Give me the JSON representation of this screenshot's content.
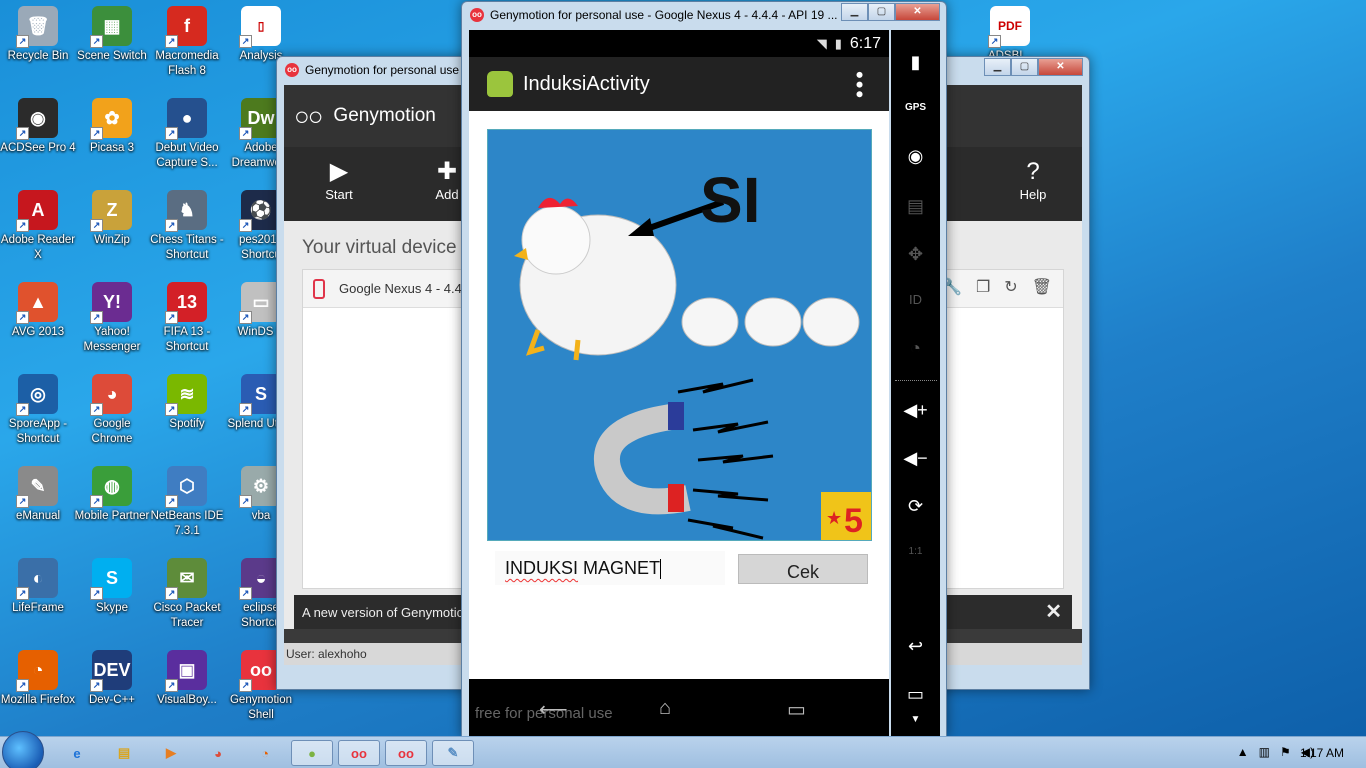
{
  "desktop": {
    "icons": [
      {
        "label": "Recycle Bin",
        "color": "#9aa9b8",
        "glyph": "🗑"
      },
      {
        "label": "Scene Switch",
        "color": "#3c8f3c",
        "glyph": "▦"
      },
      {
        "label": "Macromedia Flash 8",
        "color": "#d62a1f",
        "glyph": "f"
      },
      {
        "label": "Analysis",
        "color": "#ffffff",
        "glyph": "▯"
      },
      {
        "label": "ACDSee Pro 4",
        "color": "#2b2b2b",
        "glyph": "◉"
      },
      {
        "label": "Picasa 3",
        "color": "#f2a21b",
        "glyph": "✿"
      },
      {
        "label": "Debut Video Capture S...",
        "color": "#25508e",
        "glyph": "●"
      },
      {
        "label": "Adobe Dreamwe...",
        "color": "#4d7a1e",
        "glyph": "Dw"
      },
      {
        "label": "Adobe Reader X",
        "color": "#c6171e",
        "glyph": "A"
      },
      {
        "label": "WinZip",
        "color": "#c9a23a",
        "glyph": "Z"
      },
      {
        "label": "Chess Titans - Shortcut",
        "color": "#5a6d82",
        "glyph": "♞"
      },
      {
        "label": "pes2013 Shortcu",
        "color": "#1d2b4a",
        "glyph": "⚽"
      },
      {
        "label": "AVG 2013",
        "color": "#e0522d",
        "glyph": "▲"
      },
      {
        "label": "Yahoo! Messenger",
        "color": "#6b2c91",
        "glyph": "Y!"
      },
      {
        "label": "FIFA 13 - Shortcut",
        "color": "#d32027",
        "glyph": "13"
      },
      {
        "label": "WinDS P",
        "color": "#c0c0c0",
        "glyph": "▭"
      },
      {
        "label": "SporeApp - Shortcut",
        "color": "#1c5fa6",
        "glyph": "◎"
      },
      {
        "label": "Google Chrome",
        "color": "#dd4b39",
        "glyph": "◕"
      },
      {
        "label": "Spotify",
        "color": "#7ab800",
        "glyph": "≋"
      },
      {
        "label": "Splend Utility",
        "color": "#2a5cb3",
        "glyph": "S"
      },
      {
        "label": "eManual",
        "color": "#8a8a8a",
        "glyph": "✎"
      },
      {
        "label": "Mobile Partner",
        "color": "#3a9e3a",
        "glyph": "◍"
      },
      {
        "label": "NetBeans IDE 7.3.1",
        "color": "#3f7dc2",
        "glyph": "⬡"
      },
      {
        "label": "vba",
        "color": "#9aa",
        "glyph": "⚙"
      },
      {
        "label": "LifeFrame",
        "color": "#3a6fa8",
        "glyph": "◐"
      },
      {
        "label": "Skype",
        "color": "#00aff0",
        "glyph": "S"
      },
      {
        "label": "Cisco Packet Tracer",
        "color": "#5e8c3a",
        "glyph": "✉"
      },
      {
        "label": "eclipse Shortcu",
        "color": "#5b3a8a",
        "glyph": "◒"
      },
      {
        "label": "Mozilla Firefox",
        "color": "#e66000",
        "glyph": "◔"
      },
      {
        "label": "Dev-C++",
        "color": "#1f3d7a",
        "glyph": "DEV"
      },
      {
        "label": "VisualBoy...",
        "color": "#5a2e9e",
        "glyph": "▣"
      },
      {
        "label": "Genymotion Shell",
        "color": "#e8333d",
        "glyph": "oo"
      },
      {
        "label": "ADSBI...",
        "color": "#ffffff",
        "glyph": "PDF"
      }
    ]
  },
  "launcher": {
    "title": "Genymotion for personal use",
    "app_name": "Genymotion",
    "toolbar": {
      "start": "Start",
      "add": "Add",
      "help": "Help"
    },
    "heading": "Your virtual device",
    "device_row": "Google Nexus 4 - 4.4.",
    "notice": "A new version of Genymotic",
    "status_user": "User: alexhoho"
  },
  "emulator": {
    "title": "Genymotion for personal use - Google Nexus 4 - 4.4.4 - API 19 ...",
    "status_time": "6:17",
    "activity_title": "InduksiActivity",
    "puzzle": {
      "big_text": "SI",
      "level_badge": "5",
      "level_star": "★"
    },
    "answer_text_a": "INDUKSI",
    "answer_text_b": " MAGNET",
    "cek_label": "Cek",
    "watermark": "free for personal use",
    "side_labels": {
      "gps": "GPS",
      "id": "ID",
      "ratio": "1:1"
    }
  },
  "taskbar": {
    "clock": "1:17 AM",
    "items": [
      "ie-icon",
      "explorer-icon",
      "media-icon",
      "chrome-icon",
      "firefox-icon",
      "android-icon",
      "genymotion-icon",
      "genymotion-icon",
      "paint-icon"
    ]
  },
  "colors": {
    "accent": "#e8333d",
    "puzzle_bg": "#2d86c8",
    "android_green": "#9bc53d"
  }
}
